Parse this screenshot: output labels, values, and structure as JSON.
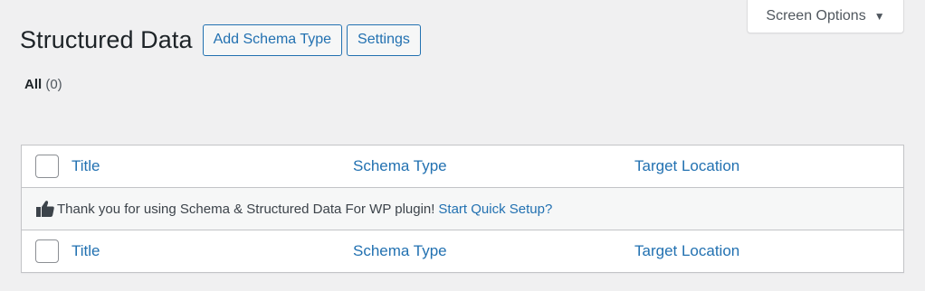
{
  "screen_options": {
    "label": "Screen Options",
    "caret": "▼"
  },
  "header": {
    "title": "Structured Data",
    "add_button": "Add Schema Type",
    "settings_button": "Settings"
  },
  "filters": {
    "all_label": "All",
    "all_count": "(0)"
  },
  "table": {
    "columns": [
      "Title",
      "Schema Type",
      "Target Location"
    ],
    "notice": {
      "icon": "thumbs-up-icon",
      "text": "Thank you for using Schema & Structured Data For WP plugin!",
      "link": "Start Quick Setup?"
    }
  },
  "colors": {
    "accent": "#2271b1",
    "background": "#f0f0f1"
  }
}
